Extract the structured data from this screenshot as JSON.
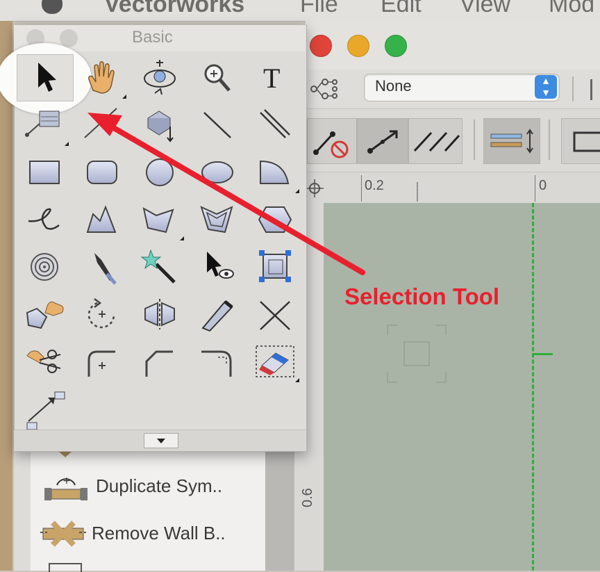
{
  "menu_bar": {
    "app_name": "Vectorworks",
    "items": [
      "File",
      "Edit",
      "View",
      "Mod"
    ]
  },
  "window": {
    "class_popup_value": "None"
  },
  "rulers": {
    "top_labels": [
      "0.2",
      "0"
    ],
    "left_labels": [
      "0.6"
    ]
  },
  "palette": {
    "title": "Basic",
    "tools": [
      {
        "name": "selection-tool",
        "icon": "arrow-pointer-icon"
      },
      {
        "name": "pan-tool",
        "icon": "hand-icon"
      },
      {
        "name": "flyover-tool",
        "icon": "flyover-icon"
      },
      {
        "name": "zoom-tool",
        "icon": "magnifier-icon"
      },
      {
        "name": "text-tool",
        "icon": "text-icon",
        "glyph": "T"
      },
      {
        "name": "callout-tool",
        "icon": "callout-icon"
      },
      {
        "name": "dimension-tool",
        "icon": "dimension-icon"
      },
      {
        "name": "symbol-insertion-tool",
        "icon": "symbol-insert-icon"
      },
      {
        "name": "line-tool",
        "icon": "line-icon"
      },
      {
        "name": "double-line-tool",
        "icon": "double-line-icon"
      },
      {
        "name": "rectangle-tool",
        "icon": "rectangle-icon"
      },
      {
        "name": "rounded-rectangle-tool",
        "icon": "rounded-rectangle-icon"
      },
      {
        "name": "circle-tool",
        "icon": "circle-icon"
      },
      {
        "name": "oval-tool",
        "icon": "oval-icon"
      },
      {
        "name": "quarter-arc-tool",
        "icon": "quarter-arc-icon"
      },
      {
        "name": "freehand-tool",
        "icon": "freehand-icon"
      },
      {
        "name": "polyline-tool",
        "icon": "polyline-icon"
      },
      {
        "name": "polygon-tool",
        "icon": "polygon-icon"
      },
      {
        "name": "double-line-polygon-tool",
        "icon": "double-polygon-icon"
      },
      {
        "name": "regular-polygon-tool",
        "icon": "hexagon-icon"
      },
      {
        "name": "spiral-tool",
        "icon": "spiral-icon"
      },
      {
        "name": "eyedropper-tool",
        "icon": "eyedropper-icon"
      },
      {
        "name": "visibility-tool",
        "icon": "magic-wand-icon"
      },
      {
        "name": "attribute-mapping-tool",
        "icon": "pointer-eye-icon"
      },
      {
        "name": "reshape-tool",
        "icon": "reshape-icon"
      },
      {
        "name": "offset-tool",
        "icon": "hand-polygon-icon"
      },
      {
        "name": "rotate-tool",
        "icon": "rotate-icon"
      },
      {
        "name": "mirror-tool",
        "icon": "mirror-icon"
      },
      {
        "name": "split-tool",
        "icon": "knife-icon"
      },
      {
        "name": "trim-tool",
        "icon": "trim-x-icon"
      },
      {
        "name": "clip-tool",
        "icon": "scissors-hand-icon"
      },
      {
        "name": "fillet-tool",
        "icon": "fillet-icon"
      },
      {
        "name": "chamfer-tool",
        "icon": "chamfer-icon"
      },
      {
        "name": "connect-combine-tool",
        "icon": "connect-icon"
      },
      {
        "name": "eraser-tool",
        "icon": "eraser-icon"
      },
      {
        "name": "move-by-points-tool",
        "icon": "move-points-icon"
      }
    ]
  },
  "lower_palette": {
    "items": [
      {
        "label": "Duplicate Sym..",
        "icon": "duplicate-symbol-icon"
      },
      {
        "label": "Remove Wall B..",
        "icon": "remove-wall-icon"
      }
    ]
  },
  "annotation": {
    "text": "Selection Tool",
    "color": "#e8202e"
  },
  "colors": {
    "drawing_area": "#a9b4a7",
    "guide_line": "#2fae3a",
    "traffic_red": "#e0443a",
    "traffic_yellow": "#e9a82a",
    "traffic_green": "#36b24a"
  }
}
